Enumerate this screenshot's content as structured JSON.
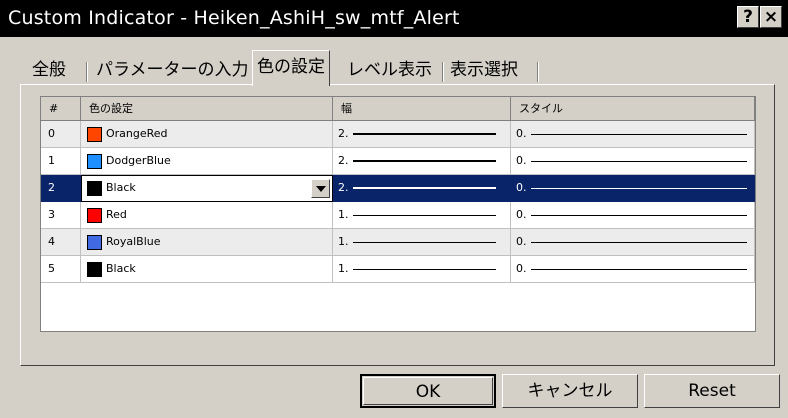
{
  "window": {
    "title": "Custom Indicator - Heiken_AshiH_sw_mtf_Alert",
    "help_label": "?",
    "close_label": "×"
  },
  "tabs": [
    {
      "label": "全般",
      "active": false
    },
    {
      "label": "パラメーターの入力",
      "active": false
    },
    {
      "label": "色の設定",
      "active": true
    },
    {
      "label": "レベル表示",
      "active": false
    },
    {
      "label": "表示選択",
      "active": false
    }
  ],
  "grid": {
    "columns": [
      "#",
      "色の設定",
      "幅",
      "スタイル"
    ],
    "rows": [
      {
        "index": "0",
        "color_name": "OrangeRed",
        "color": "#ff4500",
        "width": "2.",
        "style": "0."
      },
      {
        "index": "1",
        "color_name": "DodgerBlue",
        "color": "#1e90ff",
        "width": "2.",
        "style": "0."
      },
      {
        "index": "2",
        "color_name": "Black",
        "color": "#000000",
        "width": "2.",
        "style": "0."
      },
      {
        "index": "3",
        "color_name": "Red",
        "color": "#ff0000",
        "width": "1.",
        "style": "0."
      },
      {
        "index": "4",
        "color_name": "RoyalBlue",
        "color": "#4169e1",
        "width": "1.",
        "style": "0."
      },
      {
        "index": "5",
        "color_name": "Black",
        "color": "#000000",
        "width": "1.",
        "style": "0."
      }
    ],
    "selected_row": 2
  },
  "buttons": {
    "ok_label": "OK",
    "cancel_label": "キャンセル",
    "reset_label": "Reset"
  }
}
